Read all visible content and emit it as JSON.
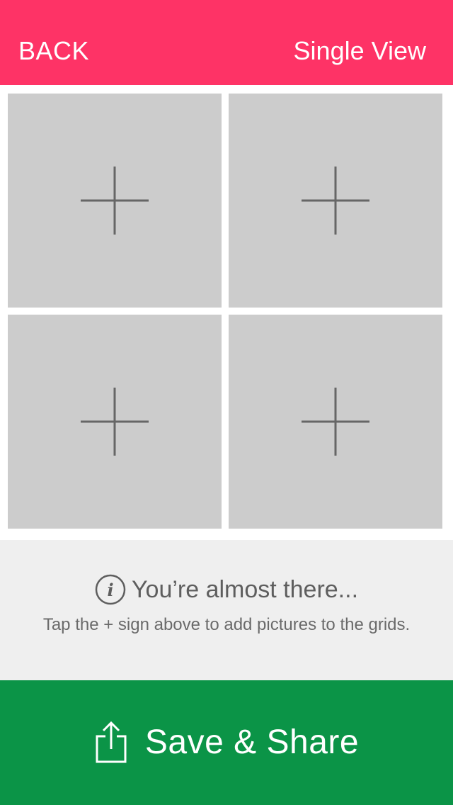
{
  "header": {
    "back_label": "BACK",
    "view_label": "Single View",
    "background": "#fe3366"
  },
  "grid": {
    "cells": [
      {
        "icon": "plus-icon"
      },
      {
        "icon": "plus-icon"
      },
      {
        "icon": "plus-icon"
      },
      {
        "icon": "plus-icon"
      }
    ],
    "cell_color": "#cccccc"
  },
  "info": {
    "icon": "info-icon",
    "title": "You’re almost there...",
    "subtitle": "Tap the + sign above to add pictures to the grids."
  },
  "save": {
    "icon": "share-icon",
    "label": "Save & Share",
    "background": "#0b9447"
  }
}
